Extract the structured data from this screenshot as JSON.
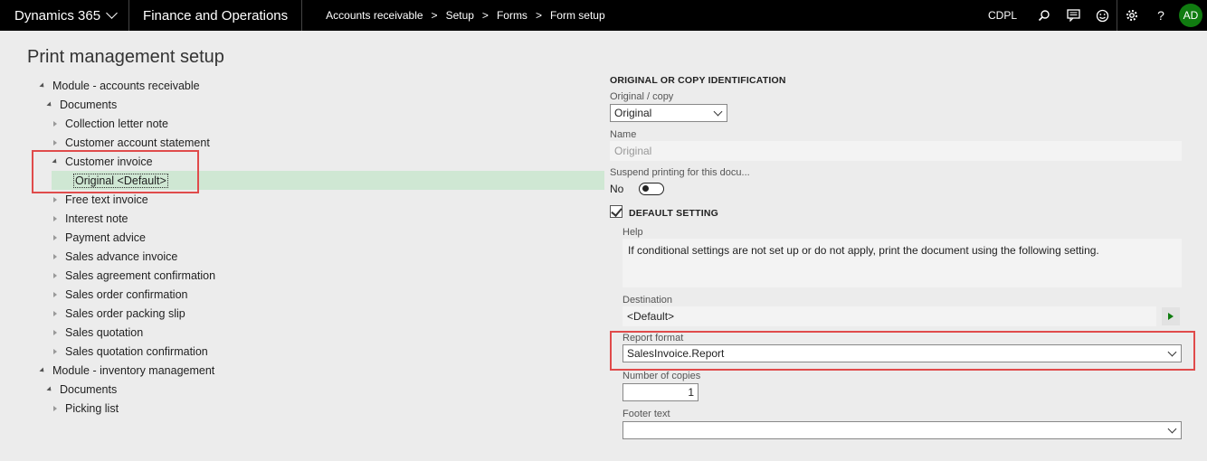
{
  "topbar": {
    "brand": "Dynamics 365",
    "app_name": "Finance and Operations",
    "breadcrumbs": [
      "Accounts receivable",
      "Setup",
      "Forms",
      "Form setup"
    ],
    "company": "CDPL",
    "avatar_initials": "AD"
  },
  "page": {
    "title": "Print management setup"
  },
  "tree": [
    {
      "label": "Module - accounts receivable"
    },
    {
      "label": "Documents"
    },
    {
      "label": "Collection letter note"
    },
    {
      "label": "Customer account statement"
    },
    {
      "label": "Customer invoice"
    },
    {
      "label": "Original <Default>"
    },
    {
      "label": "Free text invoice"
    },
    {
      "label": "Interest note"
    },
    {
      "label": "Payment advice"
    },
    {
      "label": "Sales advance invoice"
    },
    {
      "label": "Sales agreement confirmation"
    },
    {
      "label": "Sales order confirmation"
    },
    {
      "label": "Sales order packing slip"
    },
    {
      "label": "Sales quotation"
    },
    {
      "label": "Sales quotation confirmation"
    },
    {
      "label": "Module - inventory management"
    },
    {
      "label": "Documents"
    },
    {
      "label": "Picking list"
    }
  ],
  "form": {
    "section_title": "ORIGINAL OR COPY IDENTIFICATION",
    "original_copy_label": "Original / copy",
    "original_copy_value": "Original",
    "name_label": "Name",
    "name_value": "Original",
    "suspend_label": "Suspend printing for this docu...",
    "suspend_value": "No",
    "default_setting_label": "DEFAULT SETTING",
    "help_label": "Help",
    "help_text": "If conditional settings are not set up or do not apply, print the document using the following setting.",
    "destination_label": "Destination",
    "destination_value": "<Default>",
    "report_format_label": "Report format",
    "report_format_value": "SalesInvoice.Report",
    "copies_label": "Number of copies",
    "copies_value": "1",
    "footer_label": "Footer text",
    "footer_value": ""
  },
  "colors": {
    "accent": "#107c10",
    "highlight": "#e04b4b",
    "selected_row": "#cfe7d3"
  }
}
